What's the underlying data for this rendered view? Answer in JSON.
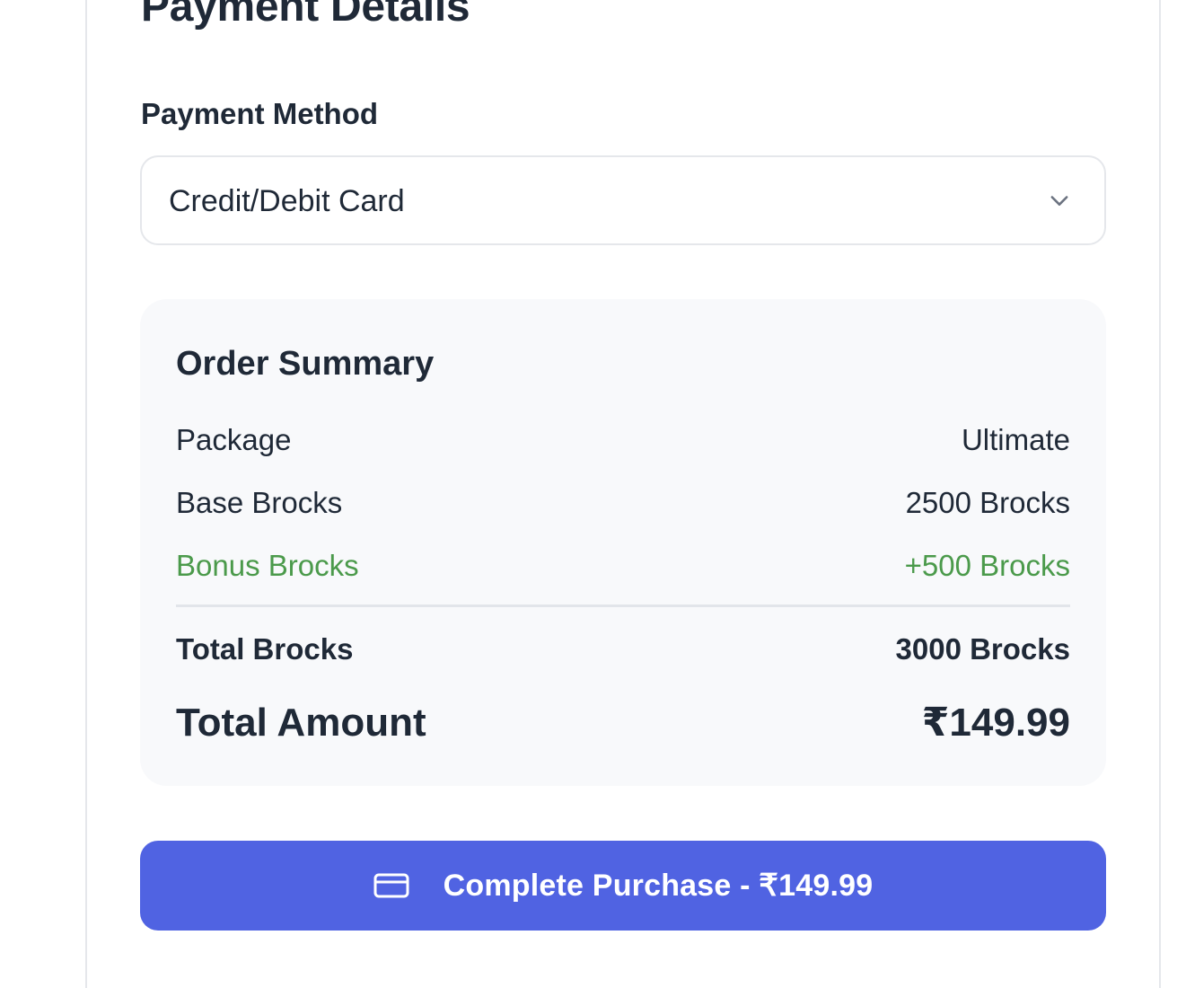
{
  "page": {
    "title": "Payment Details"
  },
  "payment_method": {
    "label": "Payment Method",
    "selected": "Credit/Debit Card",
    "chevron_icon": "chevron-down-icon"
  },
  "order_summary": {
    "title": "Order Summary",
    "rows": [
      {
        "label": "Package",
        "value": "Ultimate"
      },
      {
        "label": "Base Brocks",
        "value": "2500 Brocks"
      },
      {
        "label": "Bonus Brocks",
        "value": "+500 Brocks"
      },
      {
        "label": "Total Brocks",
        "value": "3000 Brocks"
      }
    ],
    "total": {
      "label": "Total Amount",
      "value": "₹149.99"
    }
  },
  "cta": {
    "label": "Complete Purchase - ₹149.99",
    "icon": "credit-card-icon"
  },
  "colors": {
    "accent": "#5063e2",
    "bonus": "#4b9a4b",
    "text": "#1f2937",
    "summary_bg": "#f8f9fb",
    "border": "#e5e7eb"
  }
}
